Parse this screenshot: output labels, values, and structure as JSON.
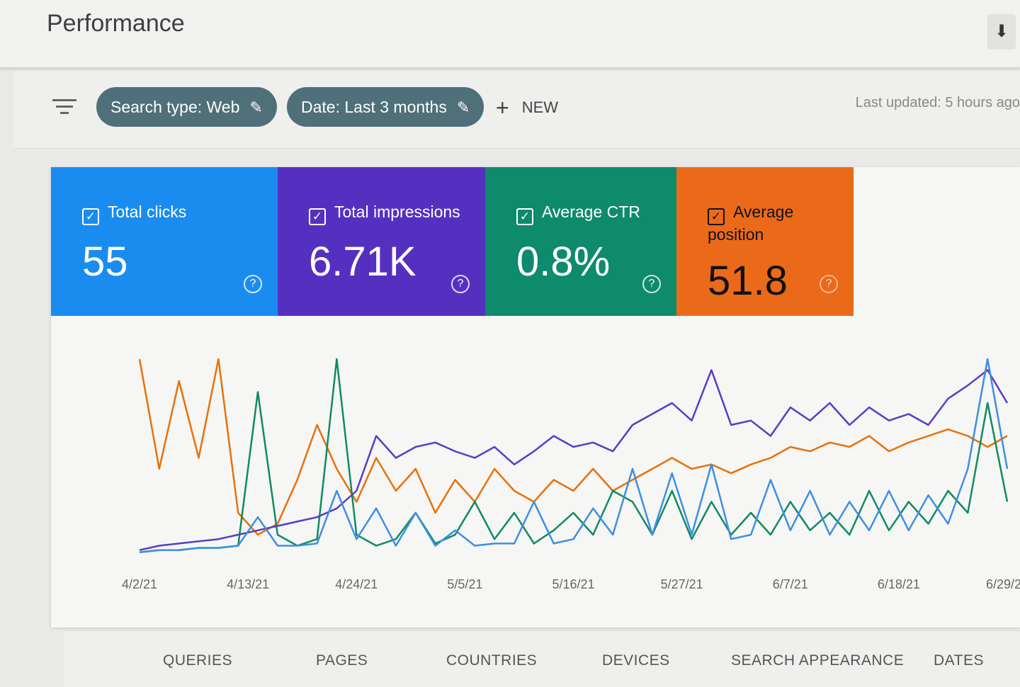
{
  "header": {
    "title": "Performance",
    "download_icon": "download-icon"
  },
  "filters": {
    "chips": [
      {
        "label": "Search type: Web"
      },
      {
        "label": "Date: Last 3 months"
      }
    ],
    "new_label": "NEW",
    "last_updated": "Last updated: 5 hours ago"
  },
  "cards": [
    {
      "label": "Total clicks",
      "value": "55",
      "color": "#1a8cf0",
      "checked": true
    },
    {
      "label": "Total impressions",
      "value": "6.71K",
      "color": "#5530c0",
      "checked": true
    },
    {
      "label": "Average CTR",
      "value": "0.8%",
      "color": "#0e8a6c",
      "checked": true
    },
    {
      "label": "Average position",
      "value": "51.8",
      "color": "#ea6a1a",
      "checked": true
    }
  ],
  "chart_data": {
    "type": "line",
    "x": [
      "4/2/21",
      "4/4/21",
      "4/6/21",
      "4/8/21",
      "4/10/21",
      "4/12/21",
      "4/14/21",
      "4/16/21",
      "4/18/21",
      "4/20/21",
      "4/22/21",
      "4/24/21",
      "4/26/21",
      "4/28/21",
      "4/30/21",
      "5/2/21",
      "5/4/21",
      "5/6/21",
      "5/8/21",
      "5/10/21",
      "5/12/21",
      "5/14/21",
      "5/16/21",
      "5/18/21",
      "5/20/21",
      "5/22/21",
      "5/24/21",
      "5/26/21",
      "5/28/21",
      "5/30/21",
      "6/1/21",
      "6/3/21",
      "6/5/21",
      "6/7/21",
      "6/9/21",
      "6/11/21",
      "6/13/21",
      "6/15/21",
      "6/17/21",
      "6/19/21",
      "6/21/21",
      "6/23/21",
      "6/25/21",
      "6/27/21",
      "6/29/21"
    ],
    "x_ticks": [
      "4/2/21",
      "4/13/21",
      "4/24/21",
      "5/5/21",
      "5/16/21",
      "5/27/21",
      "6/7/21",
      "6/18/21",
      "6/29/21"
    ],
    "grid": false,
    "series": [
      {
        "name": "Average position",
        "color": "#e8710a",
        "values": [
          90,
          40,
          80,
          45,
          90,
          20,
          10,
          15,
          35,
          60,
          40,
          25,
          45,
          30,
          40,
          20,
          35,
          25,
          40,
          30,
          25,
          35,
          30,
          40,
          30,
          35,
          40,
          45,
          40,
          42,
          38,
          42,
          45,
          50,
          48,
          52,
          50,
          55,
          48,
          52,
          55,
          58,
          55,
          50,
          55
        ]
      },
      {
        "name": "Average CTR",
        "color": "#0f8a65",
        "values": [
          2,
          3,
          3,
          4,
          4,
          5,
          75,
          10,
          5,
          8,
          90,
          10,
          5,
          8,
          20,
          6,
          10,
          25,
          8,
          20,
          6,
          12,
          20,
          10,
          30,
          25,
          10,
          30,
          8,
          25,
          10,
          20,
          10,
          25,
          12,
          20,
          10,
          30,
          12,
          25,
          15,
          30,
          20,
          70,
          25
        ]
      },
      {
        "name": "Total impressions",
        "color": "#5b3cc4",
        "values": [
          3,
          5,
          6,
          7,
          8,
          10,
          12,
          14,
          16,
          18,
          22,
          30,
          55,
          45,
          50,
          52,
          48,
          45,
          50,
          42,
          48,
          55,
          50,
          52,
          48,
          60,
          65,
          70,
          62,
          85,
          60,
          62,
          55,
          68,
          62,
          70,
          60,
          68,
          62,
          65,
          60,
          72,
          78,
          85,
          70
        ]
      },
      {
        "name": "Total clicks",
        "color": "#3d8fe0",
        "values": [
          2,
          3,
          3,
          4,
          4,
          5,
          18,
          5,
          5,
          6,
          30,
          8,
          22,
          5,
          20,
          5,
          12,
          5,
          6,
          6,
          25,
          6,
          8,
          22,
          10,
          40,
          10,
          38,
          10,
          42,
          8,
          10,
          35,
          12,
          30,
          10,
          25,
          12,
          30,
          12,
          28,
          15,
          40,
          90,
          40
        ]
      }
    ]
  },
  "tabs": [
    "QUERIES",
    "PAGES",
    "COUNTRIES",
    "DEVICES",
    "SEARCH APPEARANCE",
    "DATES"
  ]
}
